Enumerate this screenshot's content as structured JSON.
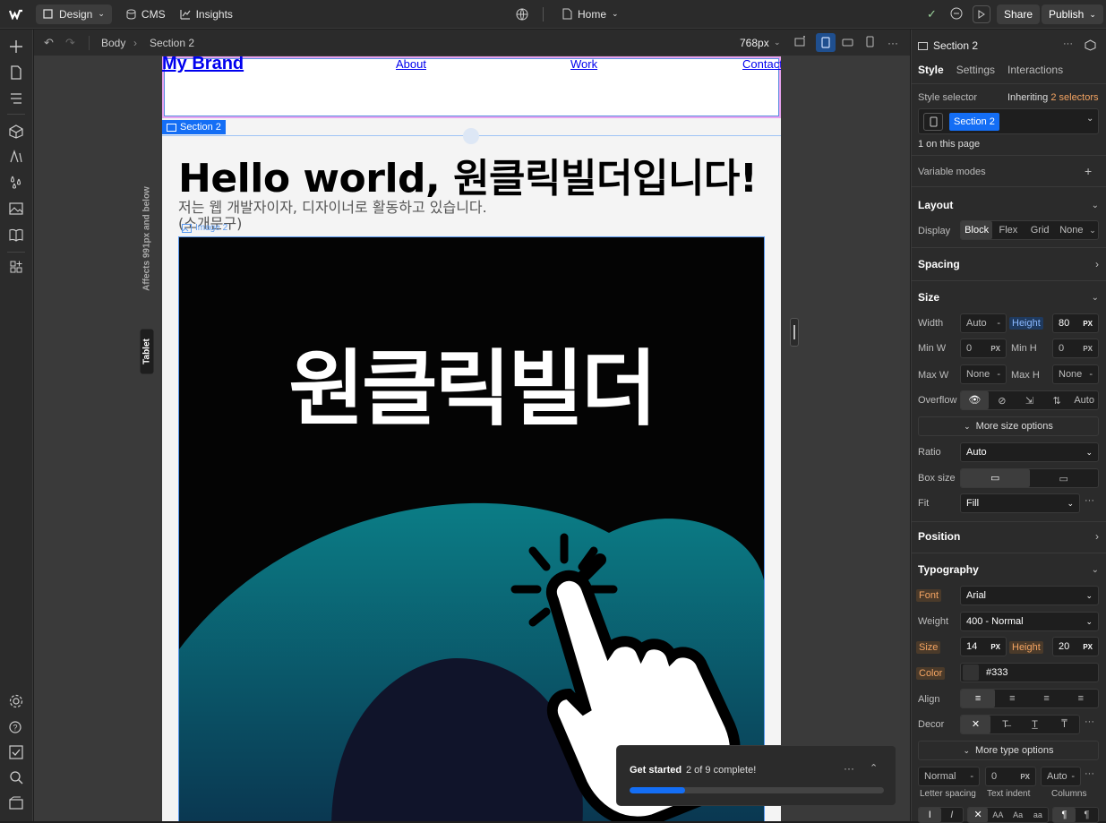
{
  "topbar": {
    "design_label": "Design",
    "cms_label": "CMS",
    "insights_label": "Insights",
    "page_label": "Home",
    "share_label": "Share",
    "publish_label": "Publish"
  },
  "subbar": {
    "breadcrumb_body": "Body",
    "breadcrumb_section": "Section 2",
    "width_label": "768px"
  },
  "canvas": {
    "brand": "My Brand",
    "nav": [
      "About",
      "Work",
      "Contact"
    ],
    "section_tag": "Section 2",
    "image_tag": "Image 2",
    "heading": "Hello world, 원클릭빌더입니다!",
    "subtext_line1": "저는 웹 개발자이자, 디자이너로 활동하고 있습니다.",
    "subtext_line2": "(소개문구)",
    "image_text": "원클릭빌더",
    "breakpoint_label": "Tablet",
    "breakpoint_note": "Affects 991px and below"
  },
  "onboarding": {
    "title": "Get started",
    "progress_text": "2 of 9 complete!",
    "progress": 0.22
  },
  "panel": {
    "element_name": "Section 2",
    "tabs": [
      "Style",
      "Settings",
      "Interactions"
    ],
    "style_selector_label": "Style selector",
    "inheriting_label": "Inheriting",
    "inheriting_count": "2 selectors",
    "selector_chip": "Section 2",
    "on_page": "1 on this page",
    "variable_modes": "Variable modes",
    "layout": {
      "title": "Layout",
      "display_label": "Display",
      "display_options": [
        "Block",
        "Flex",
        "Grid",
        "None"
      ]
    },
    "spacing_title": "Spacing",
    "size": {
      "title": "Size",
      "width_label": "Width",
      "width_value": "Auto",
      "height_label": "Height",
      "height_value": "80",
      "min_w_label": "Min W",
      "min_w_value": "0",
      "min_h_label": "Min H",
      "min_h_value": "0",
      "max_w_label": "Max W",
      "max_w_value": "None",
      "max_h_label": "Max H",
      "max_h_value": "None",
      "overflow_label": "Overflow",
      "overflow_auto": "Auto",
      "more_label": "More size options",
      "ratio_label": "Ratio",
      "ratio_value": "Auto",
      "box_size_label": "Box size",
      "fit_label": "Fit",
      "fit_value": "Fill",
      "unit": "PX"
    },
    "position_title": "Position",
    "typography": {
      "title": "Typography",
      "font_label": "Font",
      "font_value": "Arial",
      "weight_label": "Weight",
      "weight_value": "400 - Normal",
      "size_label": "Size",
      "size_value": "14",
      "height_label": "Height",
      "height_value": "20",
      "color_label": "Color",
      "color_value": "#333",
      "align_label": "Align",
      "decor_label": "Decor",
      "more_label": "More type options",
      "letter_spacing_value": "Normal",
      "letter_spacing_label": "Letter spacing",
      "text_indent_value": "0",
      "text_indent_label": "Text indent",
      "columns_value": "Auto",
      "columns_label": "Columns",
      "case_options": [
        "AA",
        "Aa",
        "aa"
      ]
    }
  },
  "colors": {
    "accent": "#146ef5",
    "orange_label": "#f4a462",
    "section_border": "#e9a3f0"
  }
}
